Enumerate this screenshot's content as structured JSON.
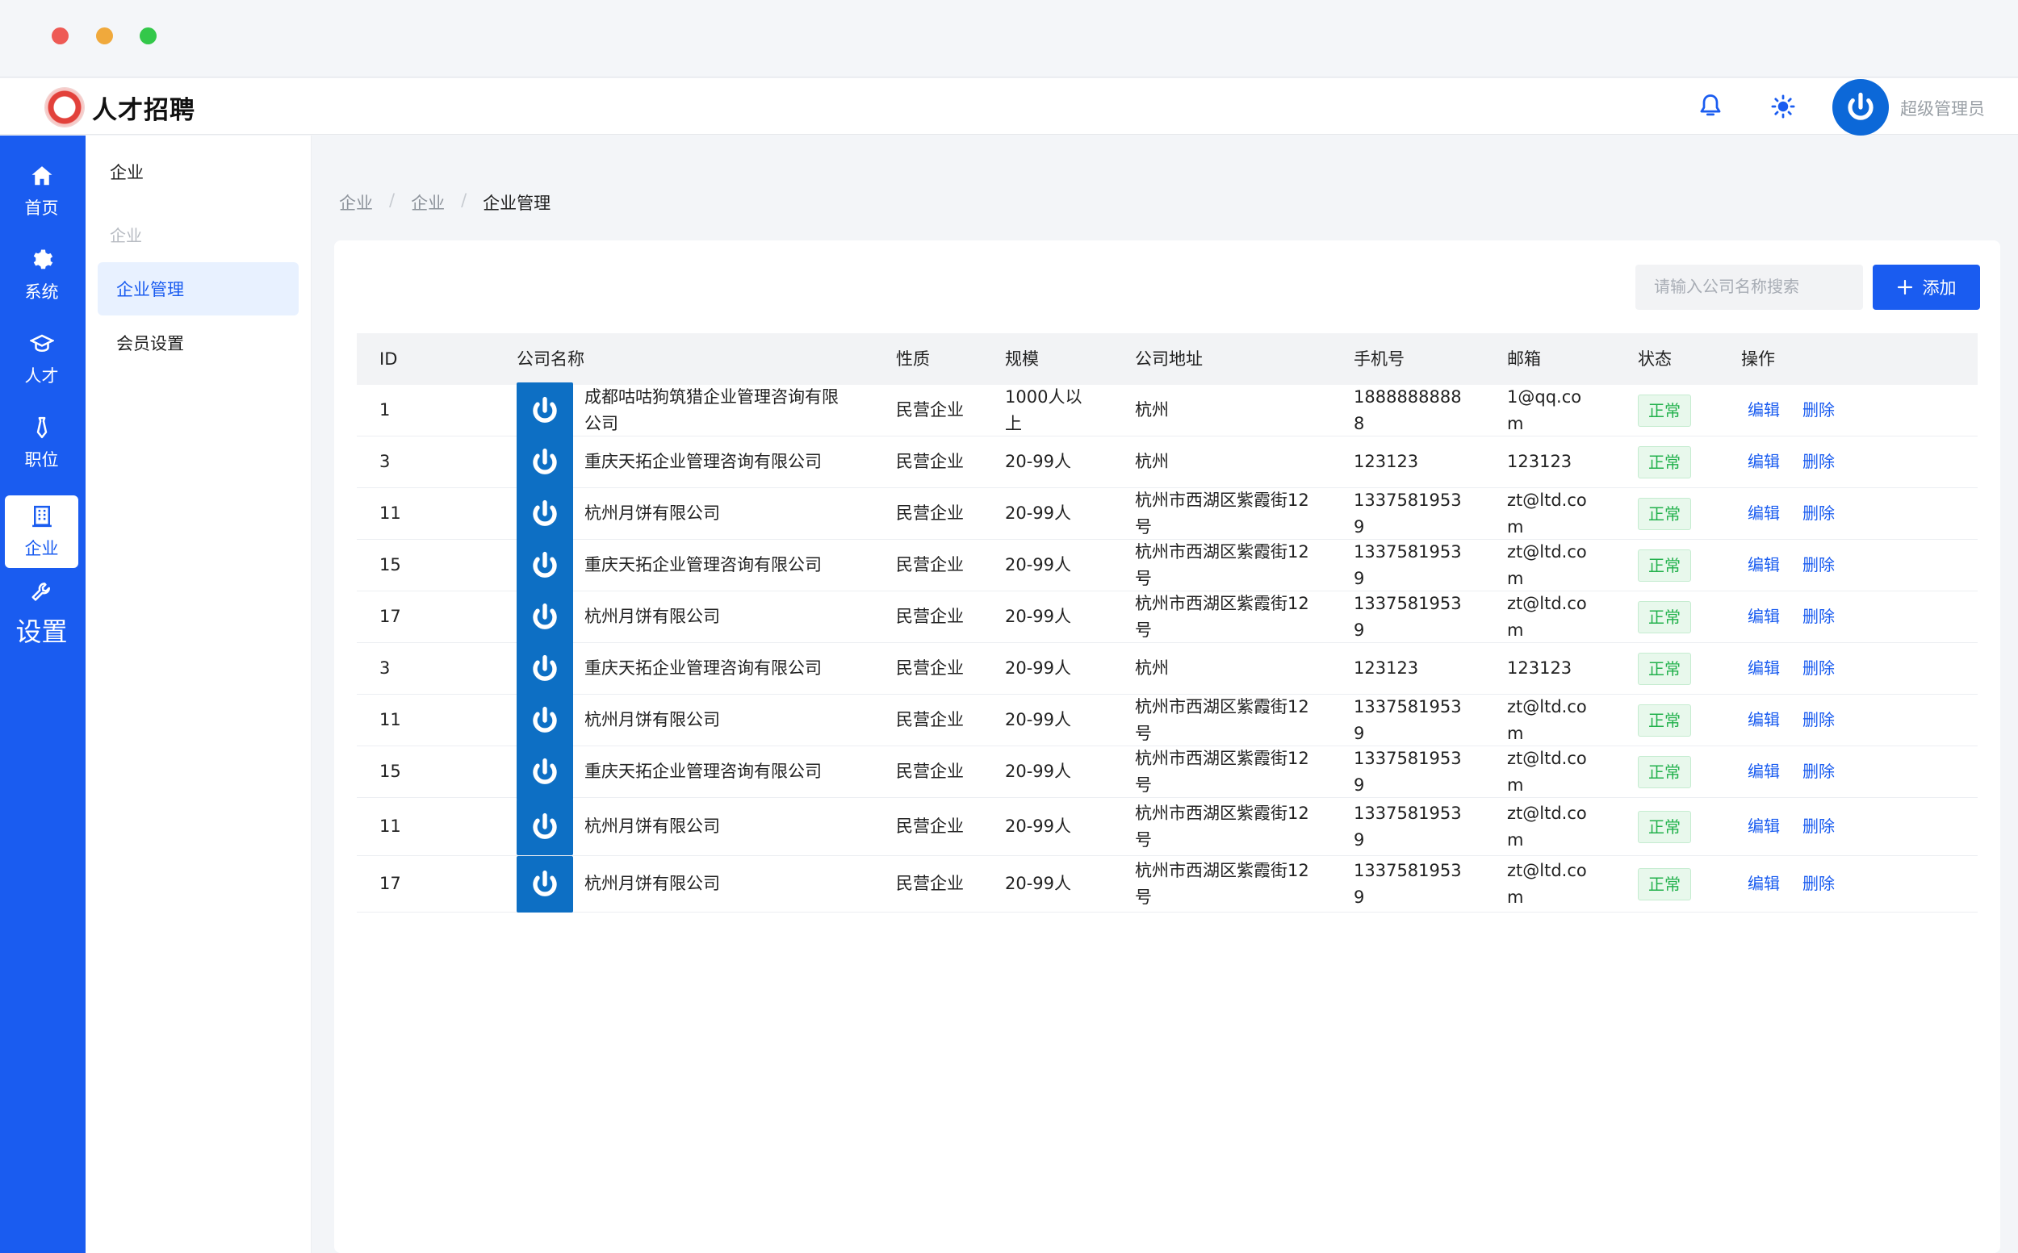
{
  "app": {
    "title": "人才招聘",
    "user_name": "超级管理员"
  },
  "colors": {
    "primary": "#1a5cf0",
    "status_ok": "#22b14c"
  },
  "rail": [
    {
      "label": "首页",
      "icon": "home-icon"
    },
    {
      "label": "系统",
      "icon": "gear-icon"
    },
    {
      "label": "人才",
      "icon": "graduation-cap-icon"
    },
    {
      "label": "职位",
      "icon": "tie-icon"
    },
    {
      "label": "企业",
      "icon": "building-icon"
    },
    {
      "label": "设置",
      "icon": "wrench-icon"
    }
  ],
  "subnav": {
    "group_title": "企业",
    "group_sub": "企业",
    "items": [
      {
        "label": "企业管理"
      },
      {
        "label": "会员设置"
      }
    ]
  },
  "breadcrumb": [
    "企业",
    "企业",
    "企业管理"
  ],
  "toolbar": {
    "search_placeholder": "请输入公司名称搜索",
    "add_label": "添加"
  },
  "table": {
    "columns": [
      "ID",
      "公司名称",
      "性质",
      "规模",
      "公司地址",
      "手机号",
      "邮箱",
      "状态",
      "操作"
    ],
    "edit_label": "编辑",
    "delete_label": "删除",
    "rows": [
      {
        "id": "1",
        "name": "成都咕咕狗筑猎企业管理咨询有限公司",
        "type": "民营企业",
        "scale": "1000人以上",
        "address": "杭州",
        "phone": "18888888888",
        "email": "1@qq.com",
        "status": "正常"
      },
      {
        "id": "3",
        "name": "重庆天拓企业管理咨询有限公司",
        "type": "民营企业",
        "scale": "20-99人",
        "address": "杭州",
        "phone": "123123",
        "email": "123123",
        "status": "正常"
      },
      {
        "id": "11",
        "name": "杭州月饼有限公司",
        "type": "民营企业",
        "scale": "20-99人",
        "address": "杭州市西湖区紫霞街12号",
        "phone": "13375819539",
        "email": "zt@ltd.com",
        "status": "正常"
      },
      {
        "id": "15",
        "name": "重庆天拓企业管理咨询有限公司",
        "type": "民营企业",
        "scale": "20-99人",
        "address": "杭州市西湖区紫霞街12号",
        "phone": "13375819539",
        "email": "zt@ltd.com",
        "status": "正常"
      },
      {
        "id": "17",
        "name": "杭州月饼有限公司",
        "type": "民营企业",
        "scale": "20-99人",
        "address": "杭州市西湖区紫霞街12号",
        "phone": "13375819539",
        "email": "zt@ltd.com",
        "status": "正常"
      },
      {
        "id": "3",
        "name": "重庆天拓企业管理咨询有限公司",
        "type": "民营企业",
        "scale": "20-99人",
        "address": "杭州",
        "phone": "123123",
        "email": "123123",
        "status": "正常"
      },
      {
        "id": "11",
        "name": "杭州月饼有限公司",
        "type": "民营企业",
        "scale": "20-99人",
        "address": "杭州市西湖区紫霞街12号",
        "phone": "13375819539",
        "email": "zt@ltd.com",
        "status": "正常"
      },
      {
        "id": "15",
        "name": "重庆天拓企业管理咨询有限公司",
        "type": "民营企业",
        "scale": "20-99人",
        "address": "杭州市西湖区紫霞街12号",
        "phone": "13375819539",
        "email": "zt@ltd.com",
        "status": "正常"
      },
      {
        "id": "11",
        "name": "杭州月饼有限公司",
        "type": "民营企业",
        "scale": "20-99人",
        "address": "杭州市西湖区紫霞街12号",
        "phone": "13375819539",
        "email": "zt@ltd.com",
        "status": "正常"
      },
      {
        "id": "17",
        "name": "杭州月饼有限公司",
        "type": "民营企业",
        "scale": "20-99人",
        "address": "杭州市西湖区紫霞街12号",
        "phone": "13375819539",
        "email": "zt@ltd.com",
        "status": "正常"
      }
    ]
  }
}
